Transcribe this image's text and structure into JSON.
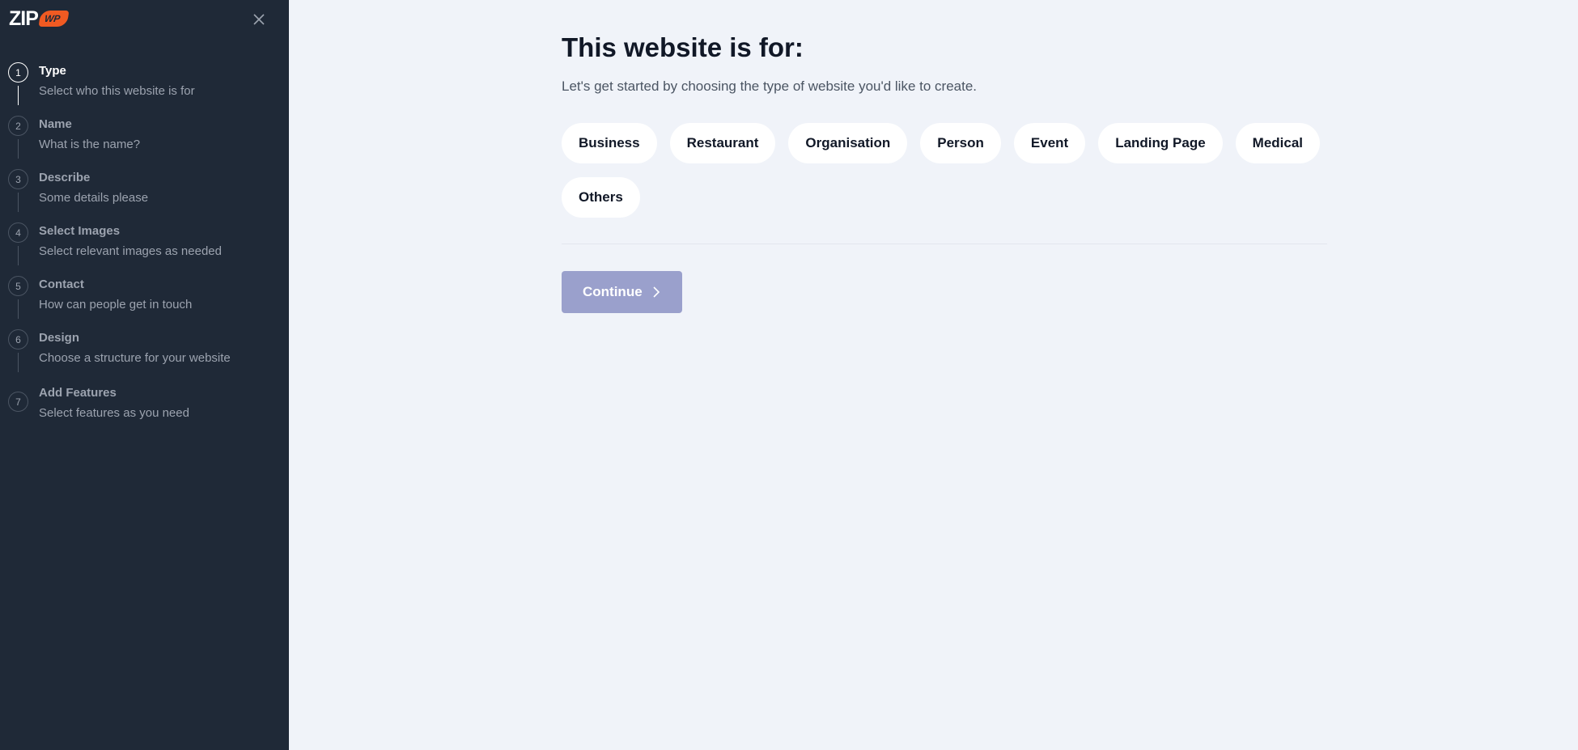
{
  "logo": {
    "text": "ZIP",
    "badge": "WP"
  },
  "steps": [
    {
      "number": "1",
      "title": "Type",
      "subtitle": "Select who this website is for"
    },
    {
      "number": "2",
      "title": "Name",
      "subtitle": "What is the name?"
    },
    {
      "number": "3",
      "title": "Describe",
      "subtitle": "Some details please"
    },
    {
      "number": "4",
      "title": "Select Images",
      "subtitle": "Select relevant images as needed"
    },
    {
      "number": "5",
      "title": "Contact",
      "subtitle": "How can people get in touch"
    },
    {
      "number": "6",
      "title": "Design",
      "subtitle": "Choose a structure for your website"
    },
    {
      "number": "7",
      "title": "Add Features",
      "subtitle": "Select features as you need"
    }
  ],
  "main": {
    "title": "This website is for:",
    "subtitle": "Let's get started by choosing the type of website you'd like to create.",
    "types": [
      "Business",
      "Restaurant",
      "Organisation",
      "Person",
      "Event",
      "Landing Page",
      "Medical",
      "Others"
    ],
    "continue_label": "Continue"
  },
  "colors": {
    "sidebar_bg": "#1f2937",
    "page_bg": "#f0f3f9",
    "brand_orange": "#f05a22",
    "continue_disabled": "#9aa0cc"
  }
}
